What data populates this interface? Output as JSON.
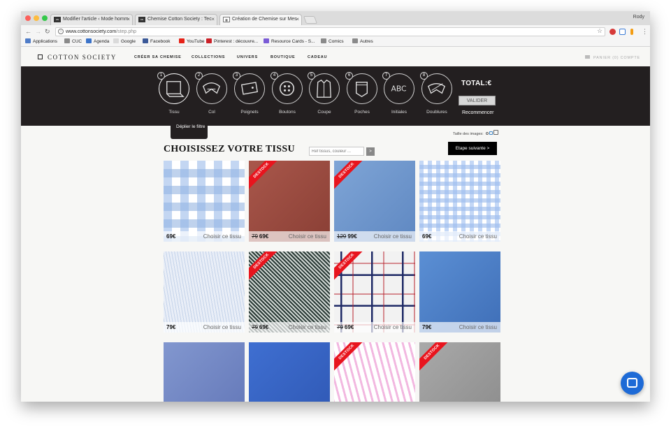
{
  "browser": {
    "tabs": [
      {
        "favicon": "cotton",
        "label": "Modifier l'article ‹ Mode homm"
      },
      {
        "favicon": "cotton",
        "label": "Chemise Cotton Society : Tec"
      },
      {
        "favicon": "grid",
        "label": "Création de Chemise sur Mes"
      }
    ],
    "user": "Rody",
    "url_host": "www.cottonsociety.com",
    "url_path": "/step.php",
    "bookmarks": [
      {
        "label": "Applications",
        "icon_color": "#4f7cc8"
      },
      {
        "label": "CUC",
        "icon_color": "#8a8a8a"
      },
      {
        "label": "Agenda",
        "icon_color": "#3b73c9"
      },
      {
        "label": "Google",
        "icon_color": "#dadada"
      },
      {
        "label": "Facebook",
        "icon_color": "#3b5998"
      },
      {
        "label": "YouTube",
        "icon_color": "#e62117"
      },
      {
        "label": "Pinterest : découvre...",
        "icon_color": "#cb2027"
      },
      {
        "label": "Resource Cards - S...",
        "icon_color": "#7a5bd6"
      },
      {
        "label": "Comics",
        "icon_color": "#8a8a8a"
      },
      {
        "label": "Autres",
        "icon_color": "#8a8a8a"
      }
    ]
  },
  "site": {
    "logo": "COTTON SOCIETY",
    "nav": [
      "CRÉER SA CHEMISE",
      "COLLECTIONS",
      "UNIVERS",
      "BOUTIQUE",
      "CADEAU"
    ],
    "cart": "PANIER (0) COMPTE"
  },
  "steps": [
    {
      "num": "1",
      "label": "Tissu",
      "icon": "fabric-icon"
    },
    {
      "num": "2",
      "label": "Col",
      "icon": "collar-icon"
    },
    {
      "num": "3",
      "label": "Poignets",
      "icon": "cuff-icon"
    },
    {
      "num": "4",
      "label": "Boutons",
      "icon": "button-icon"
    },
    {
      "num": "5",
      "label": "Coupe",
      "icon": "shirt-cut-icon"
    },
    {
      "num": "6",
      "label": "Poches",
      "icon": "pocket-icon"
    },
    {
      "num": "7",
      "label": "Initiales",
      "icon": "initials-icon",
      "glyph": "ABC"
    },
    {
      "num": "8",
      "label": "Doublures",
      "icon": "lining-icon"
    }
  ],
  "summary": {
    "total": "TOTAL:€",
    "validate": "VALIDER",
    "restart": "Recommencer"
  },
  "filter": {
    "toggle": "Déplier le filtre",
    "image_size": "Taille des images:"
  },
  "main": {
    "heading": "CHOISISSEZ VOTRE TISSU",
    "search_placeholder": "Ref tissus, couleur ...",
    "search_button": ">",
    "next": "Etape suivante >"
  },
  "destock_label": "DESTOCK",
  "choose_label": "Choisir ce tissu",
  "fabrics": [
    {
      "price": "69€",
      "old_price": "",
      "destock": false,
      "pattern": "gingham",
      "c1": "#8fb3e6",
      "c2": "#ffffff"
    },
    {
      "price": "69€",
      "old_price": "79",
      "destock": true,
      "pattern": "solid",
      "c1": "#a9574b",
      "c2": "#8a3f35"
    },
    {
      "price": "99€",
      "old_price": "129",
      "destock": true,
      "pattern": "solid",
      "c1": "#7fa5d6",
      "c2": "#5f88c2"
    },
    {
      "price": "69€",
      "old_price": "",
      "destock": false,
      "pattern": "gingham-small",
      "c1": "#9cbdf0",
      "c2": "#ffffff"
    },
    {
      "price": "79€",
      "old_price": "",
      "destock": false,
      "pattern": "pinstripe",
      "c1": "#c4d3ea",
      "c2": "#e9eef7"
    },
    {
      "price": "69€",
      "old_price": "79",
      "destock": true,
      "pattern": "houndstooth",
      "c1": "#2a3a36",
      "c2": "#cfd6d2"
    },
    {
      "price": "69€",
      "old_price": "79",
      "destock": true,
      "pattern": "tartan",
      "c1": "#1f2a66",
      "c2": "#b8222c"
    },
    {
      "price": "79€",
      "old_price": "",
      "destock": false,
      "pattern": "solid",
      "c1": "#5b8fd4",
      "c2": "#3f6fb8"
    },
    {
      "price": "",
      "old_price": "",
      "destock": false,
      "pattern": "solid",
      "c1": "#8297cf",
      "c2": "#6377b8"
    },
    {
      "price": "",
      "old_price": "",
      "destock": false,
      "pattern": "solid",
      "c1": "#3f6fd1",
      "c2": "#2f58b4"
    },
    {
      "price": "",
      "old_price": "",
      "destock": true,
      "pattern": "stripes",
      "c1": "#f2b8e0",
      "c2": "#ffffff"
    },
    {
      "price": "",
      "old_price": "",
      "destock": true,
      "pattern": "solid",
      "c1": "#a9a9a9",
      "c2": "#8c8c8c"
    }
  ]
}
